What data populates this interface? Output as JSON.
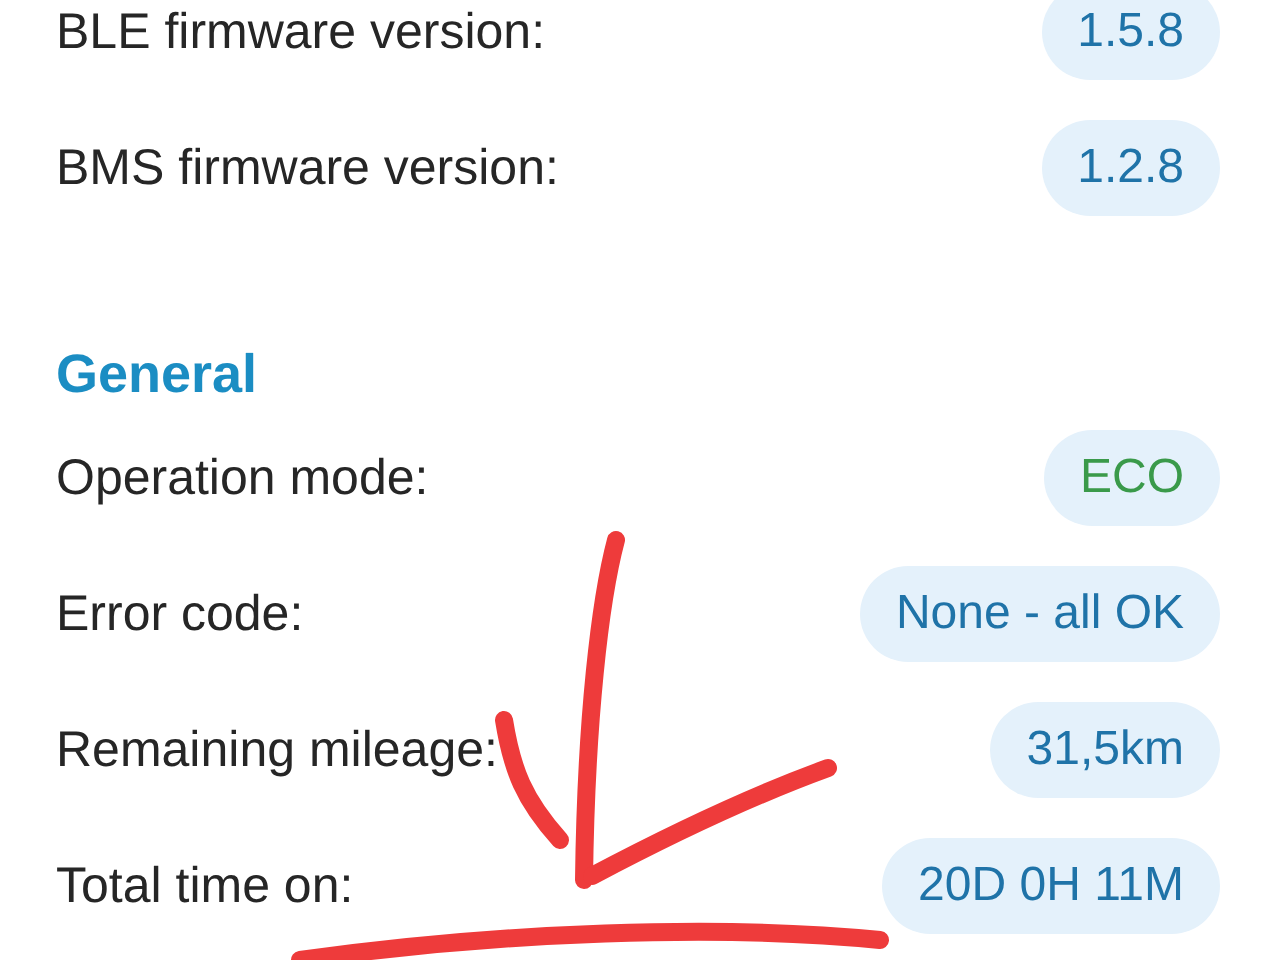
{
  "sections": [
    {
      "rows": [
        {
          "label": "BLE firmware version:",
          "value": "1.5.8",
          "color": "#1f73a8"
        },
        {
          "label": "BMS firmware version:",
          "value": "1.2.8",
          "color": "#1f73a8"
        }
      ]
    },
    {
      "title": "General",
      "rows": [
        {
          "label": "Operation mode:",
          "value": "ECO",
          "color": "#3a9a4a"
        },
        {
          "label": "Error code:",
          "value": "None - all OK",
          "color": "#1f73a8"
        },
        {
          "label": "Remaining mileage:",
          "value": "31,5km",
          "color": "#1f73a8"
        },
        {
          "label": "Total time on:",
          "value": "20D 0H 11M",
          "color": "#1f73a8"
        }
      ]
    }
  ]
}
